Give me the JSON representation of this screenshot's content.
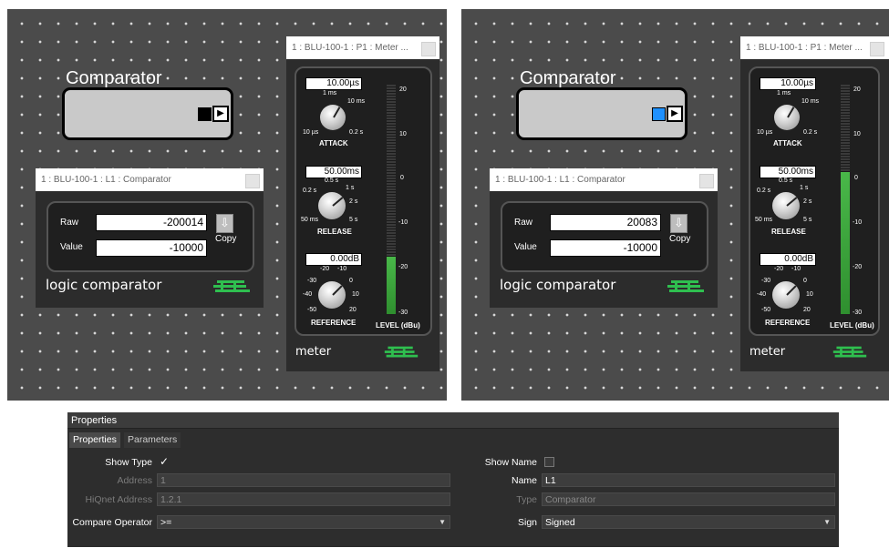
{
  "left_canvas": {
    "comparator": {
      "title": "Comparator",
      "indicator_color": "#000000"
    },
    "logic_window": {
      "title": "1 : BLU-100-1 : L1 : Comparator",
      "raw_label": "Raw",
      "raw_value": "-200014",
      "value_label": "Value",
      "value_value": "-10000",
      "copy_label": "Copy",
      "footer": "logic comparator"
    },
    "meter_window": {
      "title": "1 : BLU-100-1 : P1 : Meter ...",
      "attack_value": "10.00µs",
      "attack_label": "ATTACK",
      "release_value": "50.00ms",
      "release_label": "RELEASE",
      "reference_value": "0.00dB",
      "reference_label": "REFERENCE",
      "level_label": "LEVEL (dBu)",
      "level_fraction": 0.25,
      "footer": "meter"
    }
  },
  "right_canvas": {
    "comparator": {
      "title": "Comparator",
      "indicator_color": "#1e90ff"
    },
    "logic_window": {
      "title": "1 : BLU-100-1 : L1 : Comparator",
      "raw_label": "Raw",
      "raw_value": "20083",
      "value_label": "Value",
      "value_value": "-10000",
      "copy_label": "Copy",
      "footer": "logic comparator"
    },
    "meter_window": {
      "title": "1 : BLU-100-1 : P1 : Meter ...",
      "attack_value": "10.00µs",
      "attack_label": "ATTACK",
      "release_value": "50.00ms",
      "release_label": "RELEASE",
      "reference_value": "0.00dB",
      "reference_label": "REFERENCE",
      "level_label": "LEVEL (dBu)",
      "level_fraction": 0.62,
      "footer": "meter"
    }
  },
  "meter_marks": {
    "attack": {
      "top": "1 ms",
      "right_top": "10 ms",
      "left": "10 µs",
      "right": "0.2 s"
    },
    "release": {
      "top": "0.5 s",
      "right_top": "1 s",
      "left_top": "0.2 s",
      "right": "2 s",
      "left": "50 ms",
      "right_bottom": "5 s"
    },
    "reference": {
      "t1": "-20",
      "t2": "-10",
      "l1": "-30",
      "r1": "0",
      "l2": "-40",
      "r2": "10",
      "b1": "-50",
      "b2": "20"
    },
    "scale": [
      "20",
      "10",
      "0",
      "-10",
      "-20",
      "-30"
    ]
  },
  "properties": {
    "header": "Properties",
    "tabs": [
      "Properties",
      "Parameters"
    ],
    "left": {
      "show_type_label": "Show Type",
      "show_type_check": "✓",
      "address_label": "Address",
      "address_value": "1",
      "hiqnet_label": "HiQnet Address",
      "hiqnet_value": "1.2.1",
      "compare_label": "Compare Operator",
      "compare_value": ">="
    },
    "right": {
      "show_name_label": "Show Name",
      "name_label": "Name",
      "name_value": "L1",
      "type_label": "Type",
      "type_value": "Comparator",
      "sign_label": "Sign",
      "sign_value": "Signed"
    }
  }
}
